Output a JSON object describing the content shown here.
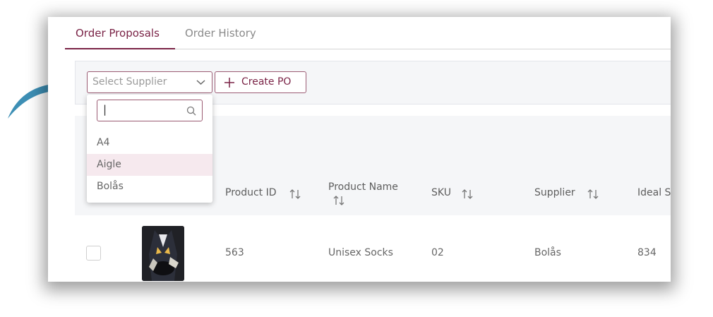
{
  "tabs": [
    {
      "label": "Order Proposals",
      "active": true
    },
    {
      "label": "Order History",
      "active": false
    }
  ],
  "toolbar": {
    "supplier_select": {
      "placeholder": "Select Supplier"
    },
    "create_po_label": "Create PO"
  },
  "dropdown": {
    "search_value": "|",
    "options": [
      "A4",
      "Aigle",
      "Bolås"
    ],
    "highlighted_option": "Aigle"
  },
  "table": {
    "columns": [
      "Product ID",
      "Product Name",
      "SKU",
      "Supplier",
      "Ideal S"
    ],
    "rows": [
      {
        "product_id": "563",
        "product_name": "Unisex Socks",
        "sku": "02",
        "supplier": "Bolås",
        "ideal": "834"
      }
    ]
  },
  "colors": {
    "accent": "#7a2346",
    "border_accent": "#9b5b73",
    "arrow": "#3d8fb5",
    "header_bg": "#f5f6f8",
    "hover_bg": "#f6e9ee"
  },
  "icons": [
    "curved-arrow-icon",
    "chevron-down-icon",
    "plus-icon",
    "search-icon",
    "sort-icon"
  ]
}
